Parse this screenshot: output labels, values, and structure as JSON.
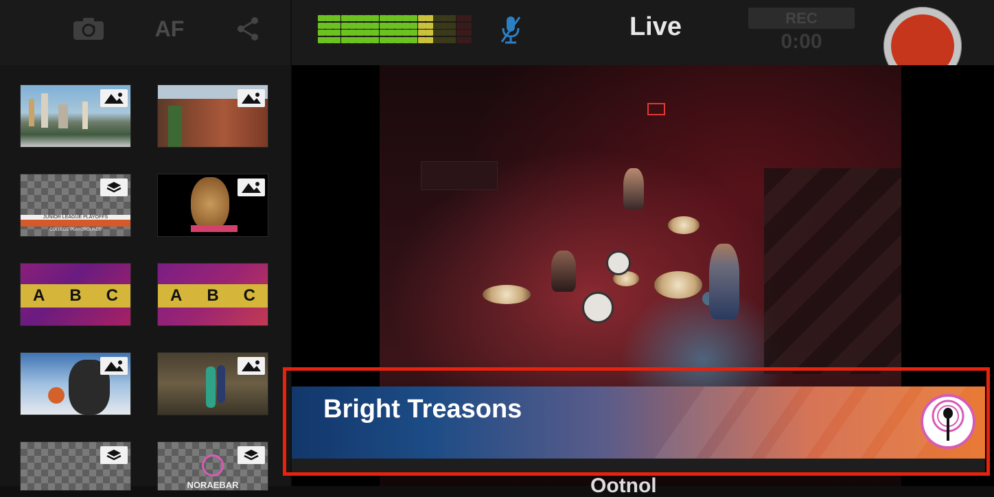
{
  "topbar": {
    "af_label": "AF",
    "live_label": "Live",
    "rec_label": "REC",
    "rec_time": "0:00",
    "icons": [
      "camera-switch-icon",
      "share-icon",
      "microphone-muted-icon",
      "record-button-icon"
    ],
    "colors": {
      "record": "#c5361c",
      "meter_green": "#6cc21f",
      "meter_yellow": "#c9c23a",
      "meter_dim": "#3a3a1a",
      "mic_blue": "#2d7fc4"
    }
  },
  "sources": [
    {
      "kind": "image"
    },
    {
      "kind": "image"
    },
    {
      "kind": "overlay",
      "title": "JUNIOR LEAGUE PLAYOFFS",
      "subtitle": "COLLEGE PLAYGROUNDS"
    },
    {
      "kind": "image"
    },
    {
      "kind": "overlay",
      "letters": [
        "A",
        "B",
        "C"
      ]
    },
    {
      "kind": "overlay",
      "letters": [
        "A",
        "B",
        "C"
      ]
    },
    {
      "kind": "image"
    },
    {
      "kind": "image"
    },
    {
      "kind": "overlay"
    },
    {
      "kind": "overlay",
      "title": "NORAEBAR"
    }
  ],
  "lower_third": {
    "title": "Bright Treasons",
    "logo_icon": "microphone-icon",
    "frame_color": "#e8220d"
  },
  "footer_partial_text": "Ootnol"
}
